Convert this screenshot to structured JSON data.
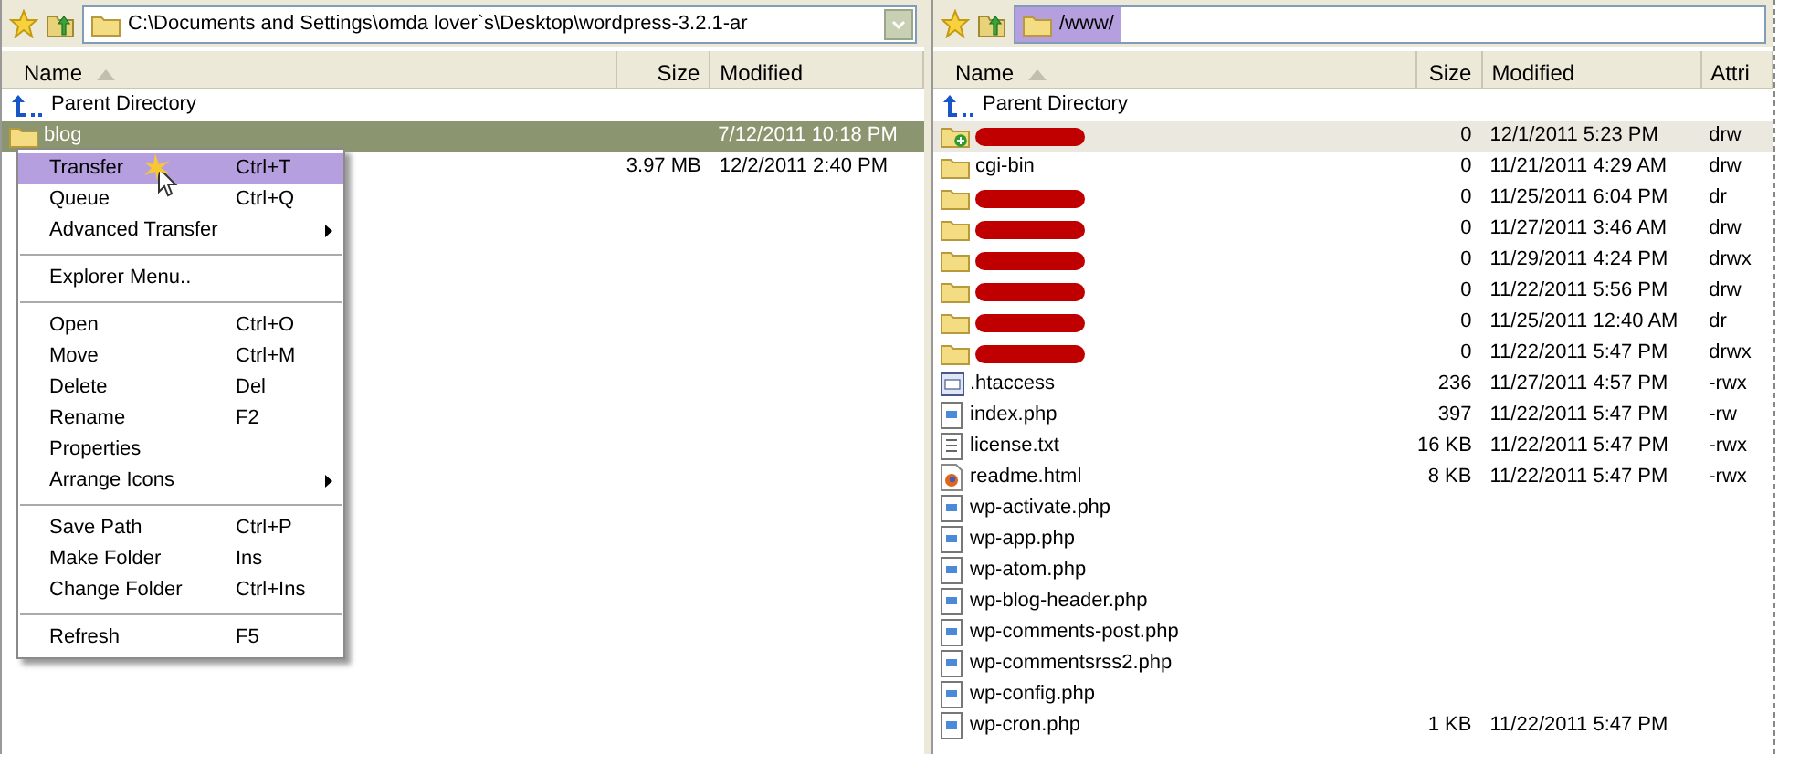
{
  "local_pane": {
    "path": "C:\\Documents and Settings\\omda lover`s\\Desktop\\wordpress-3.2.1-ar",
    "path_selected": false,
    "columns": [
      "Name",
      "Size",
      "Modified"
    ],
    "rows": [
      {
        "kind": "parent",
        "name": "Parent Directory",
        "selected": false
      },
      {
        "kind": "folder",
        "name": "blog",
        "modified": "7/12/2011 10:18 PM",
        "selected": true
      },
      {
        "kind": "file",
        "size": "3.97 MB",
        "modified": "12/2/2011 2:40 PM",
        "selected": false
      }
    ]
  },
  "context_menu": {
    "items": [
      {
        "kind": "item",
        "label": "Transfer",
        "shortcut": "Ctrl+T",
        "selected": true
      },
      {
        "kind": "item",
        "label": "Queue",
        "shortcut": "Ctrl+Q",
        "selected": false
      },
      {
        "kind": "submenu",
        "label": "Advanced Transfer",
        "selected": false
      },
      {
        "kind": "separator"
      },
      {
        "kind": "item",
        "label": "Explorer Menu..",
        "selected": false
      },
      {
        "kind": "separator"
      },
      {
        "kind": "item",
        "label": "Open",
        "shortcut": "Ctrl+O",
        "selected": false
      },
      {
        "kind": "item",
        "label": "Move",
        "shortcut": "Ctrl+M",
        "selected": false
      },
      {
        "kind": "item",
        "label": "Delete",
        "shortcut": "Del",
        "selected": false
      },
      {
        "kind": "item",
        "label": "Rename",
        "shortcut": "F2",
        "selected": false
      },
      {
        "kind": "item",
        "label": "Properties",
        "selected": false
      },
      {
        "kind": "submenu",
        "label": "Arrange Icons",
        "selected": false
      },
      {
        "kind": "separator"
      },
      {
        "kind": "item",
        "label": "Save Path",
        "shortcut": "Ctrl+P",
        "selected": false
      },
      {
        "kind": "item",
        "label": "Make Folder",
        "shortcut": "Ins",
        "selected": false
      },
      {
        "kind": "item",
        "label": "Change Folder",
        "shortcut": "Ctrl+Ins",
        "selected": false
      },
      {
        "kind": "separator"
      },
      {
        "kind": "item",
        "label": "Refresh",
        "shortcut": "F5",
        "selected": false
      }
    ]
  },
  "remote_pane": {
    "path": "/www/",
    "path_selected": true,
    "columns": [
      "Name",
      "Size",
      "Modified",
      "Attri"
    ],
    "rows": [
      {
        "kind": "parent",
        "name": "Parent Directory",
        "selected": false
      },
      {
        "kind": "folder_new",
        "redacted": true,
        "size": "0",
        "modified": "12/1/2011 5:23 PM",
        "attributes": "drw",
        "selected": true
      },
      {
        "kind": "folder",
        "name": "cgi-bin",
        "size": "0",
        "modified": "11/21/2011 4:29 AM",
        "attributes": "drw",
        "selected": false
      },
      {
        "kind": "folder",
        "redacted": true,
        "size": "0",
        "modified": "11/25/2011 6:04 PM",
        "attributes": "dr",
        "selected": false
      },
      {
        "kind": "folder",
        "redacted": true,
        "size": "0",
        "modified": "11/27/2011 3:46 AM",
        "attributes": "drw",
        "selected": false
      },
      {
        "kind": "folder",
        "redacted": true,
        "size": "0",
        "modified": "11/29/2011 4:24 PM",
        "attributes": "drwx",
        "selected": false
      },
      {
        "kind": "folder",
        "redacted": true,
        "size": "0",
        "modified": "11/22/2011 5:56 PM",
        "attributes": "drw",
        "selected": false
      },
      {
        "kind": "folder",
        "redacted": true,
        "size": "0",
        "modified": "11/25/2011 12:40 AM",
        "attributes": "dr",
        "selected": false
      },
      {
        "kind": "folder",
        "redacted": true,
        "size": "0",
        "modified": "11/22/2011 5:47 PM",
        "attributes": "drwx",
        "selected": false
      },
      {
        "kind": "config",
        "name": ".htaccess",
        "size": "236",
        "modified": "11/27/2011 4:57 PM",
        "attributes": "-rwx",
        "selected": false
      },
      {
        "kind": "php",
        "name": "index.php",
        "size": "397",
        "modified": "11/22/2011 5:47 PM",
        "attributes": "-rw",
        "selected": false
      },
      {
        "kind": "text",
        "name": "license.txt",
        "size": "16 KB",
        "modified": "11/22/2011 5:47 PM",
        "attributes": "-rwx",
        "selected": false
      },
      {
        "kind": "html",
        "name": "readme.html",
        "size": "8 KB",
        "modified": "11/22/2011 5:47 PM",
        "attributes": "-rwx",
        "selected": false
      },
      {
        "kind": "php",
        "name": "wp-activate.php",
        "selected": false
      },
      {
        "kind": "php",
        "name": "wp-app.php",
        "selected": false
      },
      {
        "kind": "php",
        "name": "wp-atom.php",
        "selected": false
      },
      {
        "kind": "php",
        "name": "wp-blog-header.php",
        "selected": false
      },
      {
        "kind": "php",
        "name": "wp-comments-post.php",
        "selected": false
      },
      {
        "kind": "php",
        "name": "wp-commentsrss2.php",
        "selected": false
      },
      {
        "kind": "php",
        "name": "wp-config.php",
        "selected": false
      },
      {
        "kind": "php",
        "name": "wp-cron.php",
        "size": "1 KB",
        "modified": "11/22/2011 5:47 PM",
        "selected": false
      }
    ]
  }
}
